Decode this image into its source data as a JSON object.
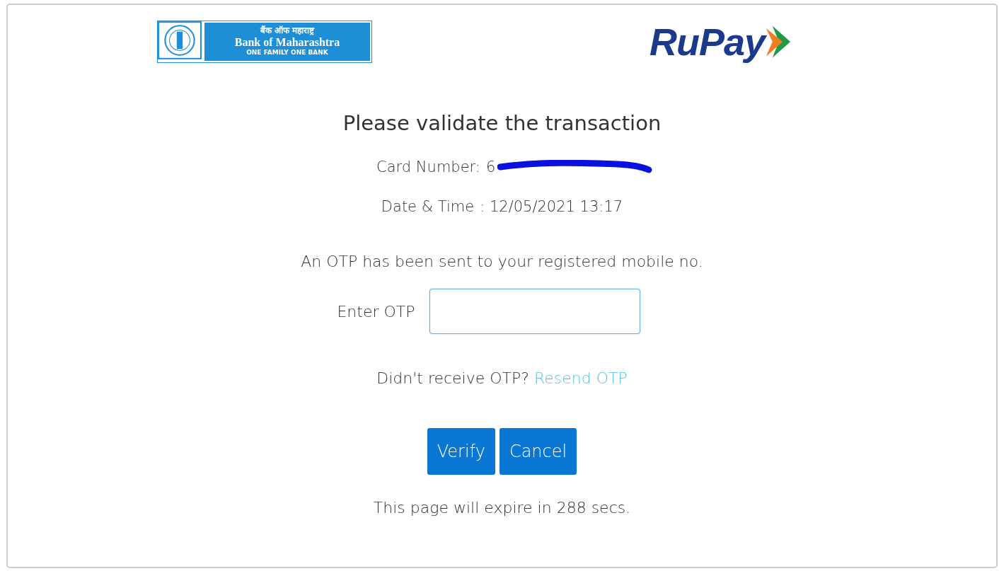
{
  "bank_logo": {
    "hindi_name": "बैंक ऑफ महाराष्ट्र",
    "name": "Bank of Maharashtra",
    "tagline": "ONE FAMILY  ONE BANK"
  },
  "network_logo": {
    "name": "RuPay"
  },
  "title": "Please validate the transaction",
  "card_number": {
    "label": "Card Number:",
    "value": "6",
    "redacted": true
  },
  "date_time": {
    "label": "Date & Time",
    "value": ": 12/05/2021 13:17"
  },
  "otp_notice": "An OTP has been sent to your registered mobile no.",
  "otp_field": {
    "label": "Enter OTP",
    "focused": true
  },
  "resend": {
    "prompt": "Didn't receive OTP?",
    "link": "Resend OTP"
  },
  "buttons": [
    {
      "label": "Verify"
    },
    {
      "label": "Cancel"
    }
  ],
  "expiry": "This page will expire in 288 secs."
}
